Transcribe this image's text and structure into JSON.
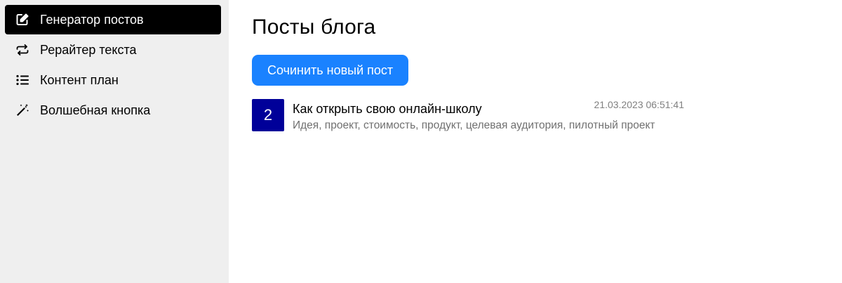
{
  "sidebar": {
    "items": [
      {
        "label": "Генератор постов",
        "icon": "edit-icon",
        "active": true
      },
      {
        "label": "Рерайтер текста",
        "icon": "repeat-icon",
        "active": false
      },
      {
        "label": "Контент план",
        "icon": "list-icon",
        "active": false
      },
      {
        "label": "Волшебная кнопка",
        "icon": "magic-wand-icon",
        "active": false
      }
    ]
  },
  "main": {
    "title": "Посты блога",
    "new_post_label": "Сочинить новый пост",
    "posts": [
      {
        "number": "2",
        "title": "Как открыть свою онлайн-школу",
        "tags": "Идея, проект, стоимость, продукт, целевая аудитория, пилотный проект",
        "date": "21.03.2023 06:51:41"
      }
    ]
  },
  "colors": {
    "accent": "#1a82ff",
    "avatar": "#000099",
    "sidebar_bg": "#efefef",
    "active_item_bg": "#000000"
  }
}
